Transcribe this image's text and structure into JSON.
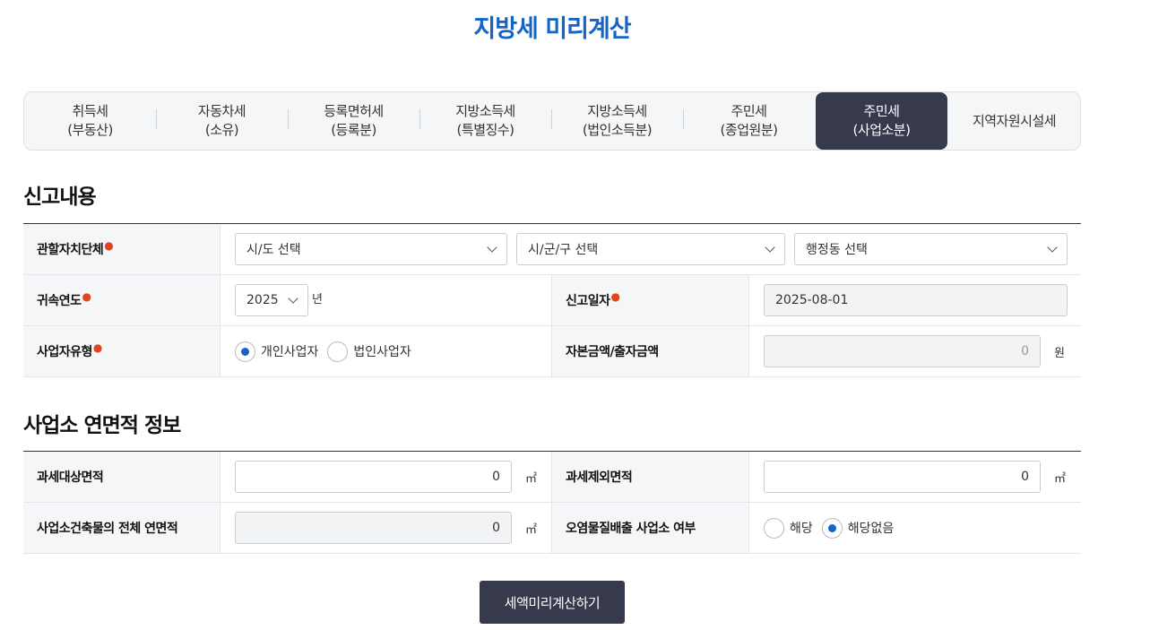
{
  "page": {
    "title": "지방세 미리계산"
  },
  "tabs": [
    {
      "line1": "취득세",
      "line2": "(부동산)",
      "active": false
    },
    {
      "line1": "자동차세",
      "line2": "(소유)",
      "active": false
    },
    {
      "line1": "등록면허세",
      "line2": "(등록분)",
      "active": false
    },
    {
      "line1": "지방소득세",
      "line2": "(특별징수)",
      "active": false
    },
    {
      "line1": "지방소득세",
      "line2": "(법인소득분)",
      "active": false
    },
    {
      "line1": "주민세",
      "line2": "(종업원분)",
      "active": false
    },
    {
      "line1": "주민세",
      "line2": "(사업소분)",
      "active": true
    },
    {
      "line1": "지역자원시설세",
      "line2": "",
      "active": false
    }
  ],
  "report": {
    "section_title": "신고내용",
    "jurisdiction": {
      "label": "관할자치단체",
      "sido_placeholder": "시/도 선택",
      "sigungu_placeholder": "시/군/구 선택",
      "dong_placeholder": "행정동 선택"
    },
    "year": {
      "label": "귀속연도",
      "value": "2025",
      "unit": "년"
    },
    "report_date": {
      "label": "신고일자",
      "value": "2025-08-01"
    },
    "business_type": {
      "label": "사업자유형",
      "options": [
        "개인사업자",
        "법인사업자"
      ],
      "selected": "개인사업자"
    },
    "capital": {
      "label": "자본금액/출자금액",
      "value": "0",
      "unit": "원"
    }
  },
  "area": {
    "section_title": "사업소 연면적 정보",
    "taxable": {
      "label": "과세대상면적",
      "value": "0",
      "unit": "㎡"
    },
    "excluded": {
      "label": "과세제외면적",
      "value": "0",
      "unit": "㎡"
    },
    "total": {
      "label": "사업소건축물의 전체 연면적",
      "value": "0",
      "unit": "㎡"
    },
    "pollutant": {
      "label": "오염물질배출 사업소 여부",
      "options": [
        "해당",
        "해당없음"
      ],
      "selected": "해당없음"
    }
  },
  "actions": {
    "calculate_label": "세액미리계산하기"
  },
  "colors": {
    "accent": "#1565c8",
    "dark": "#373a4c",
    "required": "#e0461e"
  }
}
